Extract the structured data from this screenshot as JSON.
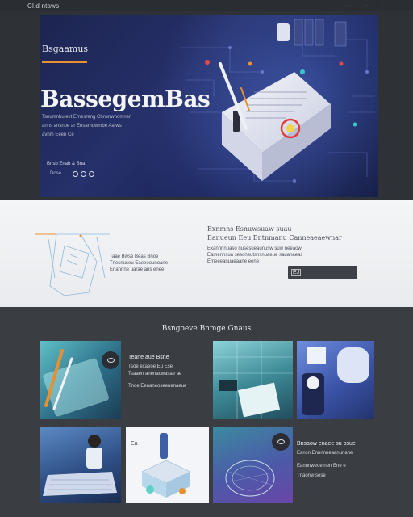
{
  "topbar": {
    "logo": "Cl.d ntaws",
    "nav": [
      "·  ·  ·",
      "·  ·  ·",
      "·  ·  ·"
    ]
  },
  "hero": {
    "eyebrow": "Bsgaamus",
    "title": "BassegemBas",
    "lines": [
      "Tsnumnbu evt Emesreng Chrwnwnomnsn",
      "anns ansnoe ar Ensamowmbe Aa ws",
      "avnm Eeen Ce"
    ],
    "cta": "Bnsb Enab & Bna",
    "cta_sub": "Dose"
  },
  "band": {
    "title": "Exnmns Esnuwsuaw suau",
    "subtitle": "Eanueun Eeu Entnmanu Canneaeaewnar",
    "right_lines": [
      "Exanhnnuaso nusesueaunusw suw neeaow",
      "Eamennsua sesoneutsnsnuaeue sauanaeas",
      "Emeeeanuaeaane eene"
    ],
    "left_lines": [
      "Taae Bwse Beas Bnoe",
      "Tnesnuseu Eaeeeounoane",
      "Enannne uarae ans enee"
    ],
    "button_label": "EJ"
  },
  "gallery": {
    "title": "Bsngoeve Bnmge Gnaus",
    "tile1_lines": [
      "Teane aue Bsne",
      "Tsoe exaeoe Eu Ese",
      "Tsaaen anenacwasae ae",
      "Tnoe Eenaneoseeuenaeue"
    ],
    "tile2_lines": [
      "Bnsaow enaee su bsue",
      "Eansn Ennnnneaanunane",
      "Eanunweoe nen Ene e",
      "Tnaonw sese"
    ],
    "tile_badge": "Ea"
  },
  "colors": {
    "accent": "#e8902f",
    "hero_bg": "#1f2858",
    "page_bg": "#3a3d42",
    "band_bg": "#f1f2f4"
  }
}
